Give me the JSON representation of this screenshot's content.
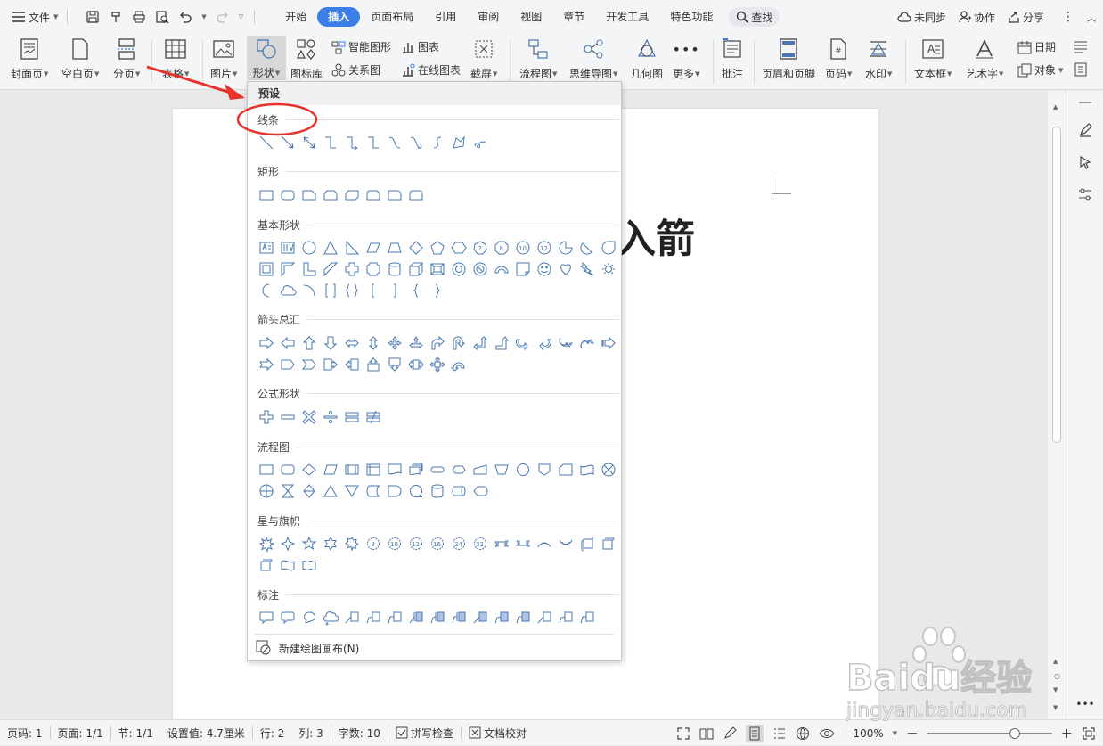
{
  "topbar": {
    "file_label": "文件",
    "tabs": [
      {
        "label": "开始",
        "active": false
      },
      {
        "label": "插入",
        "active": true
      },
      {
        "label": "页面布局",
        "active": false
      },
      {
        "label": "引用",
        "active": false
      },
      {
        "label": "审阅",
        "active": false
      },
      {
        "label": "视图",
        "active": false
      },
      {
        "label": "章节",
        "active": false
      },
      {
        "label": "开发工具",
        "active": false
      },
      {
        "label": "特色功能",
        "active": false
      }
    ],
    "search_label": "查找",
    "sync_label": "未同步",
    "collab_label": "协作",
    "share_label": "分享"
  },
  "ribbon": {
    "cover": "封面页",
    "blank": "空白页",
    "pagebreak": "分页",
    "table": "表格",
    "picture": "图片",
    "shapes": "形状",
    "iconlib": "图标库",
    "smartart": "智能图形",
    "relation": "关系图",
    "chart": "图表",
    "online_chart": "在线图表",
    "screenshot": "截屏",
    "flowchart": "流程图",
    "mindmap": "思维导图",
    "geometry": "几何图",
    "more": "更多",
    "comment": "批注",
    "header_footer": "页眉和页脚",
    "page_number": "页码",
    "watermark": "水印",
    "textbox": "文本框",
    "wordart": "艺术字",
    "date": "日期",
    "object": "对象"
  },
  "document": {
    "heading_fragment": "入箭"
  },
  "dropdown": {
    "header": "预设",
    "sections": {
      "lines": "线条",
      "rect": "矩形",
      "basic": "基本形状",
      "arrows": "箭头总汇",
      "formula": "公式形状",
      "flow": "流程图",
      "stars": "星与旗帜",
      "callouts": "标注"
    },
    "new_canvas": "新建绘图画布(N)"
  },
  "status": {
    "page_no": "页码: 1",
    "page_of": "页面: 1/1",
    "section": "节: 1/1",
    "setting": "设置值: 4.7厘米",
    "line": "行: 2",
    "col": "列: 3",
    "words": "字数: 10",
    "spell": "拼写检查",
    "proof": "文档校对",
    "zoom": "100%",
    "zoom_fraction": 0.7
  },
  "watermark_text": {
    "brand": "Baidu经验",
    "url": "jingyan.baidu.com"
  },
  "colors": {
    "accent": "#3c7ee8",
    "shape_stroke": "#4a77b0",
    "annotation_red": "#e8322b"
  }
}
